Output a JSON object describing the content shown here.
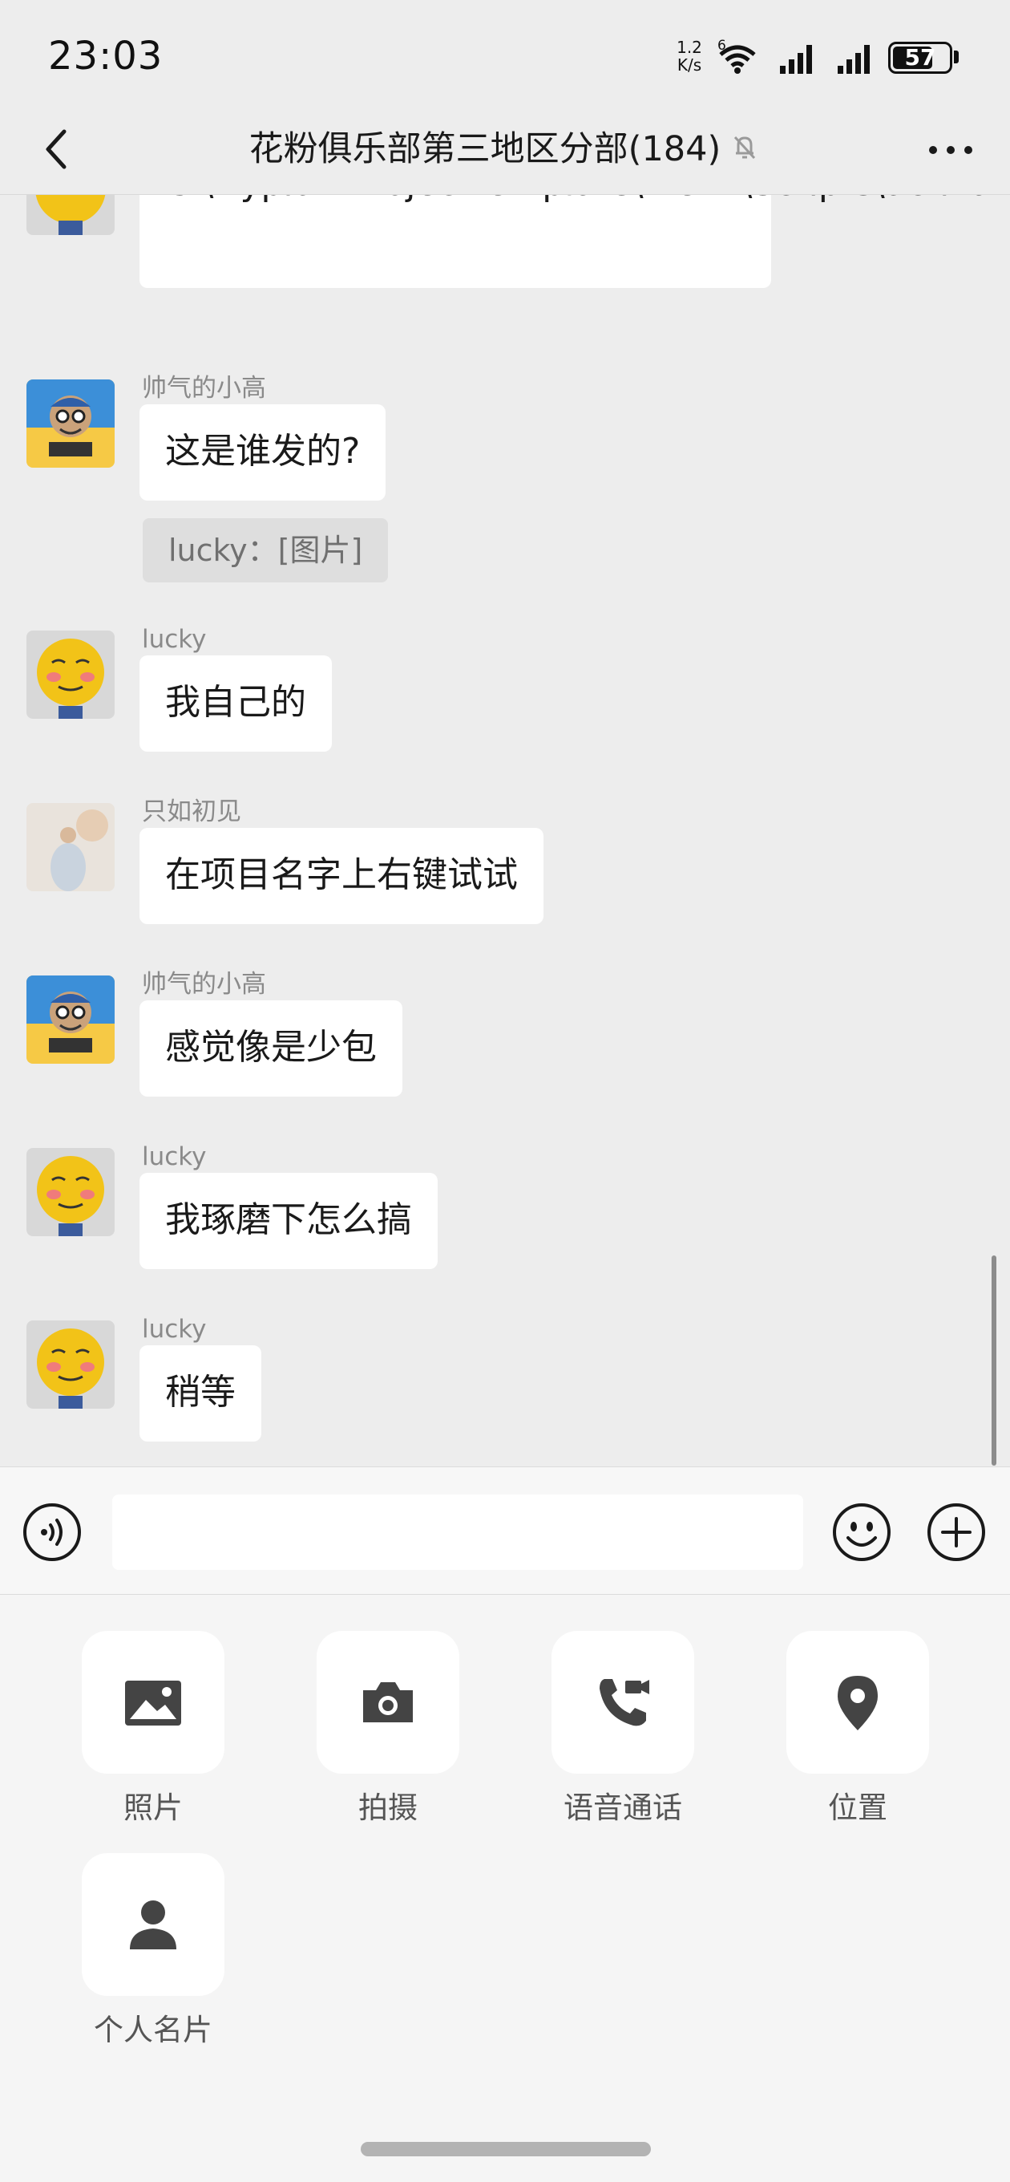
{
  "status_bar": {
    "time": "23:03",
    "net_speed_value": "1.2",
    "net_speed_unit": "K/s",
    "network_type": "6",
    "battery": "57"
  },
  "header": {
    "title": "花粉俱乐部第三地区分部(184)",
    "back_icon": "chevron-left-icon",
    "mute_icon": "bell-off-icon",
    "more_icon": "more-horizontal-icon"
  },
  "messages": [
    {
      "sender": "",
      "avatar": "yellow-face-avatar",
      "text": "C:\\HypiumProjectTemplate\\.venv\\Scripts\\activate"
    },
    {
      "sender": "帅气的小高",
      "avatar": "monkey-avatar",
      "text": "这是谁发的?",
      "quote": "lucky：[图片]"
    },
    {
      "sender": "lucky",
      "avatar": "yellow-face-avatar",
      "text": "我自己的"
    },
    {
      "sender": "只如初见",
      "avatar": "photo-avatar",
      "text": "在项目名字上右键试试"
    },
    {
      "sender": "帅气的小高",
      "avatar": "monkey-avatar",
      "text": "感觉像是少包"
    },
    {
      "sender": "lucky",
      "avatar": "yellow-face-avatar",
      "text": "我琢磨下怎么搞"
    },
    {
      "sender": "lucky",
      "avatar": "yellow-face-avatar",
      "text": "稍等"
    }
  ],
  "input": {
    "value": "",
    "placeholder": "",
    "voice_icon": "voice-icon",
    "emoji_icon": "emoji-icon",
    "plus_icon": "plus-circle-icon"
  },
  "tools": [
    {
      "label": "照片",
      "icon": "image-icon"
    },
    {
      "label": "拍摄",
      "icon": "camera-icon"
    },
    {
      "label": "语音通话",
      "icon": "phone-video-icon"
    },
    {
      "label": "位置",
      "icon": "location-pin-icon"
    },
    {
      "label": "个人名片",
      "icon": "person-icon"
    }
  ]
}
